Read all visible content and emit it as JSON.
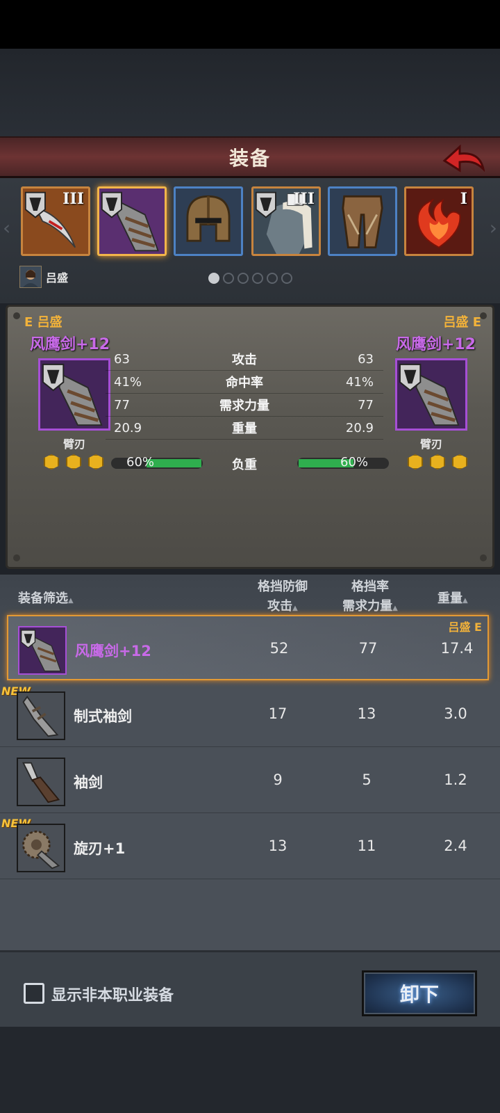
{
  "header": {
    "title": "装备"
  },
  "slots": [
    {
      "name": "curved-blade",
      "tier": "III",
      "selected": false
    },
    {
      "name": "arm-blade",
      "tier": "",
      "selected": true
    },
    {
      "name": "helmet",
      "tier": "",
      "selected": false
    },
    {
      "name": "fur-armor",
      "tier": "III",
      "selected": false
    },
    {
      "name": "leg-armor",
      "tier": "",
      "selected": false
    },
    {
      "name": "fire-emblem",
      "tier": "I",
      "selected": false
    }
  ],
  "character": {
    "name": "吕盛"
  },
  "pager": {
    "count": 6,
    "active": 0
  },
  "compare": {
    "left": {
      "header": "E 吕盛",
      "item_name": "风鹰剑+12",
      "type": "臂刃",
      "gems": 3
    },
    "right": {
      "header": "吕盛 E",
      "item_name": "风鹰剑+12",
      "type": "臂刃",
      "gems": 3
    },
    "stats": [
      {
        "label": "攻击",
        "left": "63",
        "right": "63"
      },
      {
        "label": "命中率",
        "left": "41%",
        "right": "41%"
      },
      {
        "label": "需求力量",
        "left": "77",
        "right": "77"
      },
      {
        "label": "重量",
        "left": "20.9",
        "right": "20.9"
      }
    ],
    "load": {
      "label": "负重",
      "left_text": "60%",
      "right_text": "60%",
      "left_fraction": 0.6,
      "right_fraction": 0.6
    }
  },
  "list": {
    "headers": {
      "filter": "装备筛选",
      "col1_top": "格挡防御",
      "col1_bottom": "攻击",
      "col2_top": "格挡率",
      "col2_bottom": "需求力量",
      "col3": "重量"
    },
    "items": [
      {
        "name": "风鹰剑+12",
        "v1": "52",
        "v2": "77",
        "v3": "17.4",
        "equipped": true,
        "owner": "吕盛 E",
        "badge": ""
      },
      {
        "name": "制式袖剑",
        "v1": "17",
        "v2": "13",
        "v3": "3.0",
        "equipped": false,
        "owner": "",
        "badge": "NEW"
      },
      {
        "name": "袖剑",
        "v1": "9",
        "v2": "5",
        "v3": "1.2",
        "equipped": false,
        "owner": "",
        "badge": ""
      },
      {
        "name": "旋刃+1",
        "v1": "13",
        "v2": "11",
        "v3": "2.4",
        "equipped": false,
        "owner": "",
        "badge": "NEW"
      }
    ]
  },
  "bottom": {
    "checkbox_label": "显示非本职业装备",
    "unequip_label": "卸下"
  },
  "colors": {
    "rarity_purple": "#c86ae8",
    "accent_gold": "#f2b23a",
    "load_green": "#2fae4e"
  }
}
